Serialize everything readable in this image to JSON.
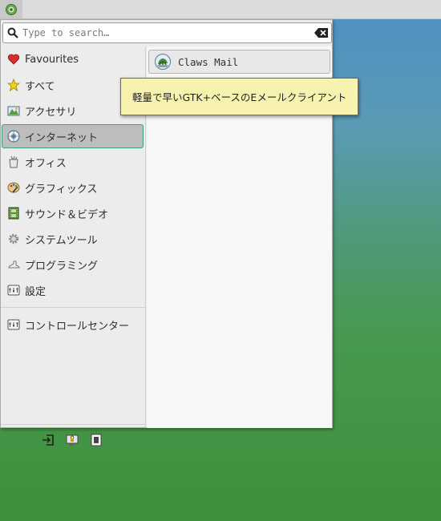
{
  "search": {
    "placeholder": "Type to search…",
    "value": ""
  },
  "categories": [
    {
      "label": "Favourites",
      "icon": "heart-icon"
    },
    {
      "label": "すべて",
      "icon": "star-icon"
    },
    {
      "label": "アクセサリ",
      "icon": "accessories-icon"
    },
    {
      "label": "インターネット",
      "icon": "globe-icon",
      "selected": true
    },
    {
      "label": "オフィス",
      "icon": "office-icon"
    },
    {
      "label": "グラフィックス",
      "icon": "palette-icon"
    },
    {
      "label": "サウンド＆ビデオ",
      "icon": "film-icon"
    },
    {
      "label": "システムツール",
      "icon": "gear-icon"
    },
    {
      "label": "プログラミング",
      "icon": "shoe-icon"
    },
    {
      "label": "設定",
      "icon": "settings-icon"
    }
  ],
  "control_center": {
    "label": "コントロールセンター",
    "icon": "control-center-icon"
  },
  "apps": [
    {
      "label": "Claws Mail",
      "icon": "claws-mail-icon"
    }
  ],
  "tooltip": {
    "text": "軽量で早いGTK+ベースのEメールクライアント"
  },
  "bottom_buttons": [
    "logout-icon",
    "lock-screen-icon",
    "switch-user-icon"
  ],
  "colors": {
    "selection_border": "#3f9f7c",
    "tooltip_bg": "#f7f2b0"
  }
}
